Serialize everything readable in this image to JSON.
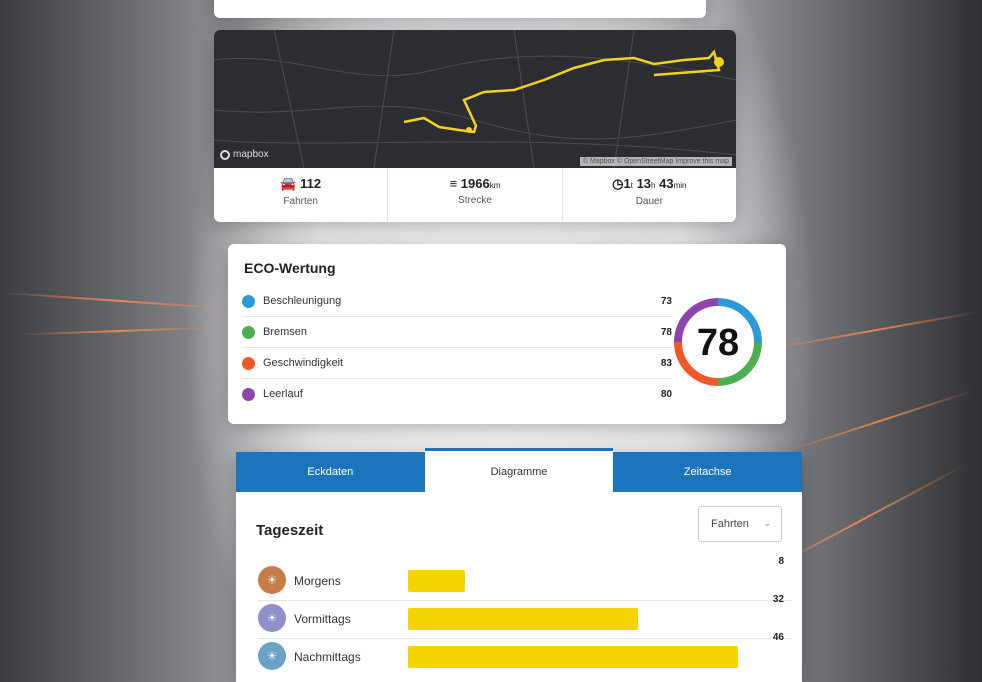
{
  "map": {
    "attribution_logo": "mapbox",
    "attribution_text": "© Mapbox © OpenStreetMap Improve this map"
  },
  "stats": [
    {
      "icon": "car-icon",
      "value": "112",
      "unit": "",
      "label": "Fahrten"
    },
    {
      "icon": "road-icon",
      "value": "1966",
      "unit": "km",
      "label": "Strecke"
    },
    {
      "icon": "clock-icon",
      "value": "1",
      "unit": "t",
      "value2": "13",
      "unit2": "h",
      "value3": "43",
      "unit3": "min",
      "label": "Dauer"
    }
  ],
  "eco": {
    "title": "ECO-Wertung",
    "items": [
      {
        "label": "Beschleunigung",
        "value": "73",
        "color": "#2d9ad8"
      },
      {
        "label": "Bremsen",
        "value": "78",
        "color": "#4caf50"
      },
      {
        "label": "Geschwindigkeit",
        "value": "83",
        "color": "#f0582a"
      },
      {
        "label": "Leerlauf",
        "value": "80",
        "color": "#8e44ad"
      }
    ],
    "score": "78"
  },
  "tabs": [
    {
      "label": "Eckdaten",
      "active": false
    },
    {
      "label": "Diagramme",
      "active": true
    },
    {
      "label": "Zeitachse",
      "active": false
    }
  ],
  "tageszeit": {
    "title": "Tageszeit",
    "select_value": "Fahrten",
    "max": 46,
    "rows": [
      {
        "label": "Morgens",
        "value": 8,
        "icon_color": "#c77d4a"
      },
      {
        "label": "Vormittags",
        "value": 32,
        "icon_color": "#8f8fc9"
      },
      {
        "label": "Nachmittags",
        "value": 46,
        "icon_color": "#6aa3c9"
      }
    ]
  }
}
